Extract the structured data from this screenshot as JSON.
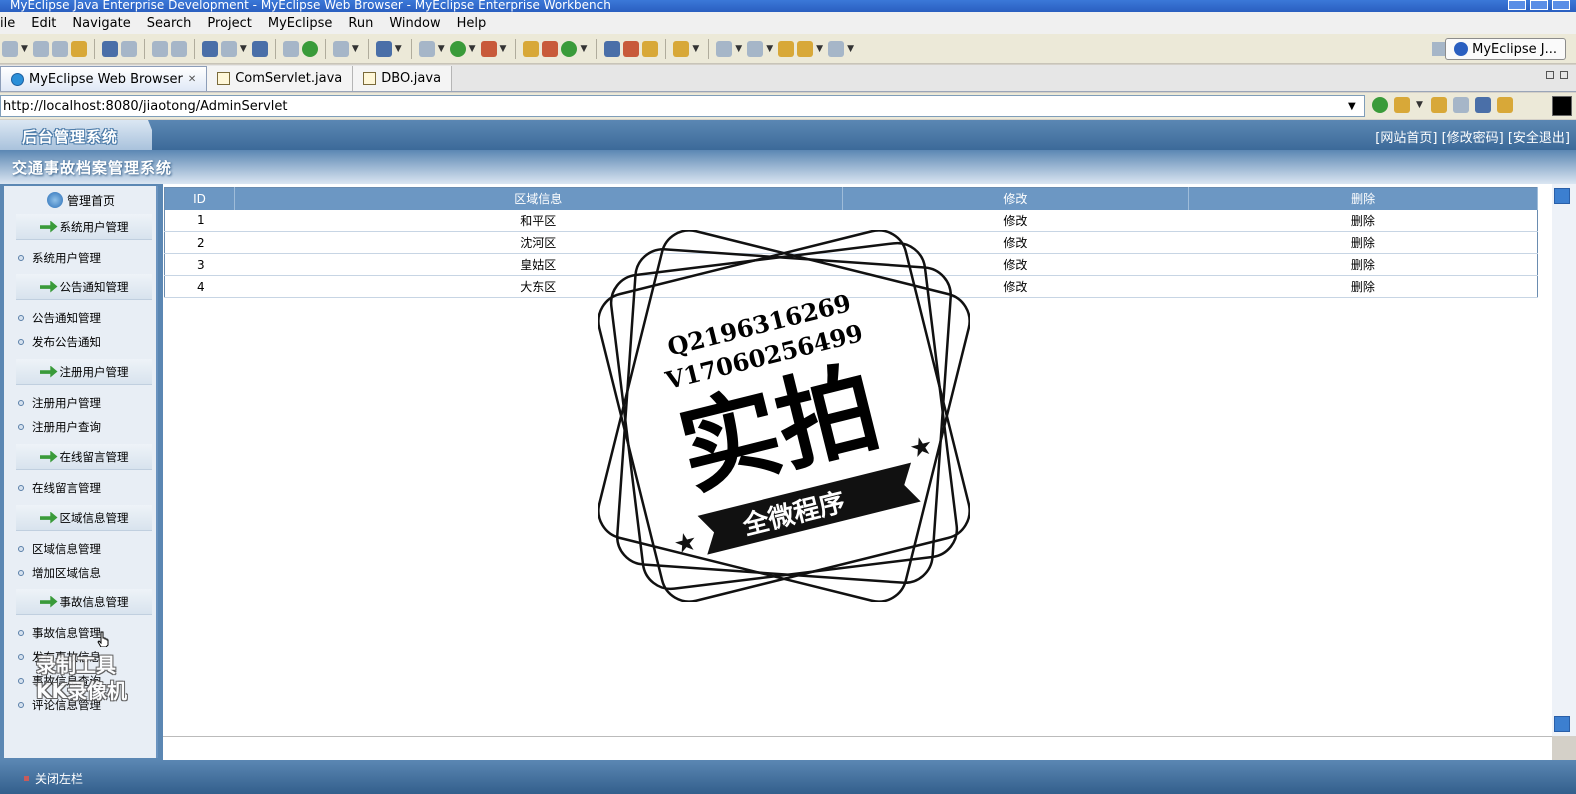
{
  "window": {
    "title": "MyEclipse Java Enterprise Development - MyEclipse Web Browser - MyEclipse Enterprise Workbench"
  },
  "menu": [
    "ile",
    "Edit",
    "Navigate",
    "Search",
    "Project",
    "MyEclipse",
    "Run",
    "Window",
    "Help"
  ],
  "perspective": {
    "label": "MyEclipse J..."
  },
  "tabs": [
    {
      "label": "MyEclipse Web Browser",
      "active": true
    },
    {
      "label": "ComServlet.java",
      "active": false
    },
    {
      "label": "DBO.java",
      "active": false
    }
  ],
  "browser": {
    "url": "http://localhost:8080/jiaotong/AdminServlet"
  },
  "header": {
    "logo": "后台管理系统",
    "links": "[网站首页] [修改密码] [安全退出]",
    "system_title": "交通事故档案管理系统"
  },
  "sidebar": {
    "home": "管理首页",
    "groups": [
      {
        "label": "系统用户管理",
        "items": [
          "系统用户管理"
        ]
      },
      {
        "label": "公告通知管理",
        "items": [
          "公告通知管理",
          "发布公告通知"
        ]
      },
      {
        "label": "注册用户管理",
        "items": [
          "注册用户管理",
          "注册用户查询"
        ]
      },
      {
        "label": "在线留言管理",
        "items": [
          "在线留言管理"
        ]
      },
      {
        "label": "区域信息管理",
        "items": [
          "区域信息管理",
          "增加区域信息"
        ]
      },
      {
        "label": "事故信息管理",
        "items": [
          "事故信息管理",
          "发布事故信息",
          "事故信息查询",
          "评论信息管理"
        ]
      }
    ],
    "close_label": "关闭左栏"
  },
  "table": {
    "headers": [
      "ID",
      "区域信息",
      "修改",
      "删除"
    ],
    "rows": [
      {
        "id": "1",
        "area": "和平区",
        "edit": "修改",
        "del": "删除"
      },
      {
        "id": "2",
        "area": "沈河区",
        "edit": "修改",
        "del": "删除"
      },
      {
        "id": "3",
        "area": "皇姑区",
        "edit": "修改",
        "del": "删除"
      },
      {
        "id": "4",
        "area": "大东区",
        "edit": "修改",
        "del": "删除"
      }
    ]
  },
  "watermark": {
    "line1": "Q2196316269",
    "line2": "V17060256499",
    "main": "实拍",
    "banner": "全微程序",
    "recorder_line1": "录制工具",
    "recorder_line2": "KK录像机"
  }
}
